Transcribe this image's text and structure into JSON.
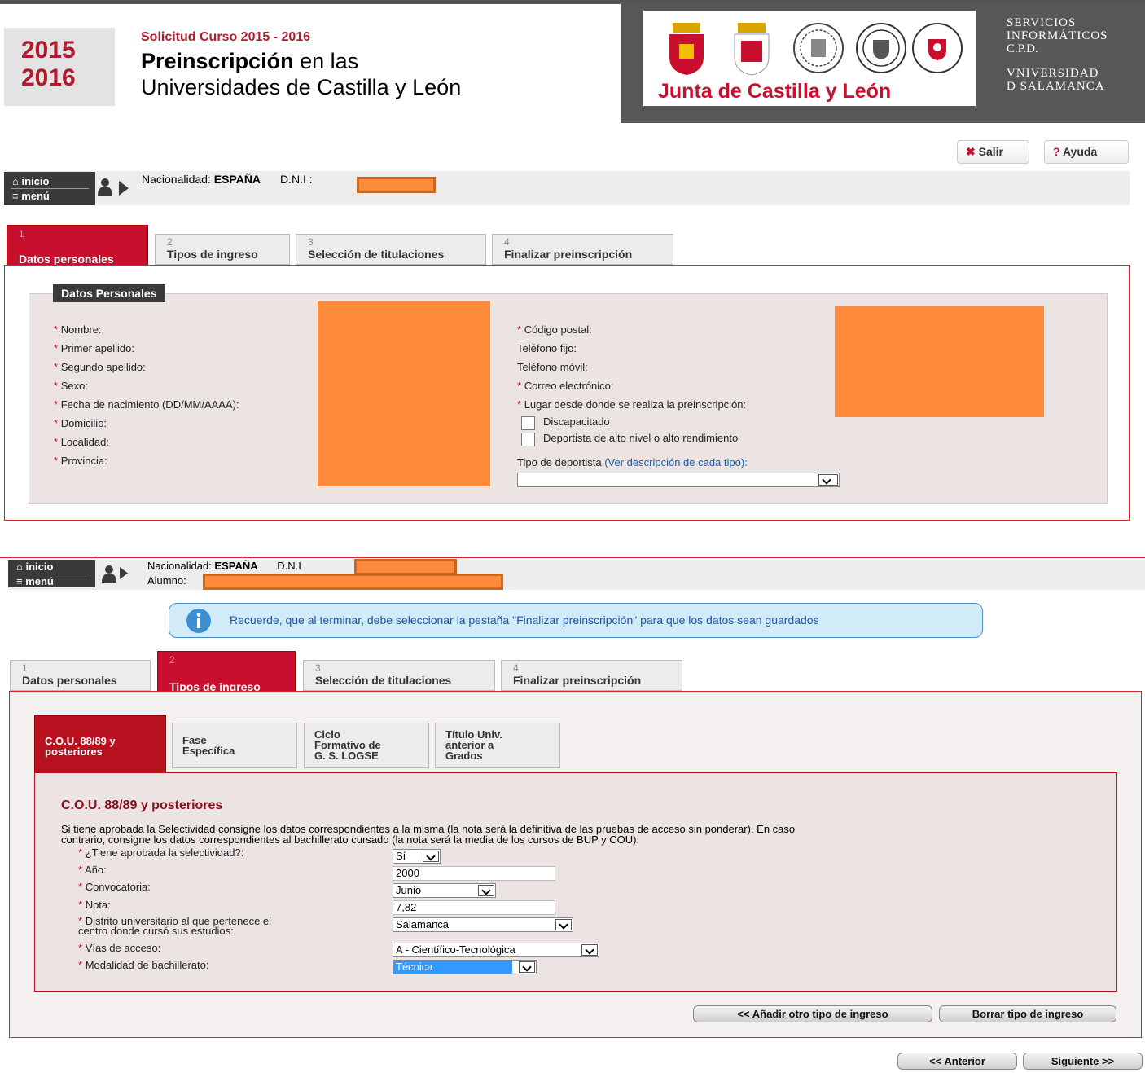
{
  "header": {
    "year1": "2015",
    "year2": "2016",
    "subtitle": "Solicitud Curso 2015 - 2016",
    "title_bold": "Preinscripción",
    "title_rest": " en las",
    "title_line2": "Universidades de Castilla y León",
    "junta": "Junta de Castilla y León",
    "usal_lines": [
      "SERVICIOS",
      "INFORMÁTICOS",
      "C.P.D.",
      "",
      "VNIVERSIDAD",
      "Ð SALAMANCA"
    ]
  },
  "top_buttons": {
    "salir": "Salir",
    "ayuda": "Ayuda"
  },
  "nav": {
    "inicio": "inicio",
    "menu": "menú"
  },
  "userbar1": {
    "nac_label": "Nacionalidad:",
    "nac_value": "ESPAÑA",
    "dni_label": "D.N.I :"
  },
  "userbar2": {
    "nac_label": "Nacionalidad:",
    "nac_value": "ESPAÑA",
    "dni_label": "D.N.I",
    "alumno_label": "Alumno:"
  },
  "tabs": [
    {
      "num": "1",
      "label": "Datos personales"
    },
    {
      "num": "2",
      "label": "Tipos de ingreso"
    },
    {
      "num": "3",
      "label": "Selección de titulaciones"
    },
    {
      "num": "4",
      "label": "Finalizar preinscripción"
    }
  ],
  "datos": {
    "legend": "Datos Personales",
    "left_fields": [
      "Nombre:",
      "Primer apellido:",
      "Segundo apellido:",
      "Sexo:",
      "Fecha de nacimiento (DD/MM/AAAA):",
      "Domicilio:",
      "Localidad:",
      "Provincia:"
    ],
    "right_fields": [
      {
        "label": "Código postal:",
        "req": true
      },
      {
        "label": "Teléfono fijo:",
        "req": false
      },
      {
        "label": "Teléfono móvil:",
        "req": false
      },
      {
        "label": "Correo electrónico:",
        "req": true
      },
      {
        "label": "Lugar desde donde se realiza la preinscripción:",
        "req": true
      }
    ],
    "discapacitado": "Discapacitado",
    "deportista": "Deportista de alto nivel o alto rendimiento",
    "tipo_deportista": "Tipo de deportista",
    "ver_desc": "(Ver descripción de cada tipo):"
  },
  "info_message": "Recuerde, que al terminar, debe seleccionar la pestaña \"Finalizar preinscripción\" para que los datos sean guardados",
  "subtabs": [
    {
      "l1": "C.O.U. 88/89 y",
      "l2": "posteriores",
      "l3": ""
    },
    {
      "l1": "Fase",
      "l2": "Específica",
      "l3": ""
    },
    {
      "l1": "Ciclo",
      "l2": "Formativo de",
      "l3": "G. S. LOGSE"
    },
    {
      "l1": "Título Univ.",
      "l2": "anterior a",
      "l3": "Grados"
    }
  ],
  "cou": {
    "heading": "C.O.U. 88/89 y posteriores",
    "desc1": "Si tiene aprobada la Selectividad consigne los datos correspondientes a la misma (la nota será la definitiva de las pruebas de acceso sin ponderar). En caso",
    "desc2": "contrario, consigne los datos correspondientes al bachillerato cursado (la nota será la media de los cursos de BUP y COU).",
    "labels": {
      "selectividad": "¿Tiene aprobada la selectividad?:",
      "anio": "Año:",
      "convocatoria": "Convocatoria:",
      "nota": "Nota:",
      "distrito1": "Distrito universitario al que pertenece el",
      "distrito2": "centro donde cursó sus estudios:",
      "vias": "Vías de acceso:",
      "modalidad": "Modalidad de bachillerato:"
    },
    "values": {
      "selectividad": "Sí",
      "anio": "2000",
      "convocatoria": "Junio",
      "nota": "7,82",
      "distrito": "Salamanca",
      "vias": "A - Científico-Tecnológica",
      "modalidad": "Técnica"
    }
  },
  "buttons": {
    "anadir": "<< Añadir otro tipo de ingreso",
    "borrar": "Borrar tipo de ingreso",
    "anterior": "<< Anterior",
    "siguiente": "Siguiente >>"
  },
  "colors": {
    "accent": "#c8102e",
    "redact": "#fe8a3b",
    "info_bg": "#d2ebf9"
  }
}
